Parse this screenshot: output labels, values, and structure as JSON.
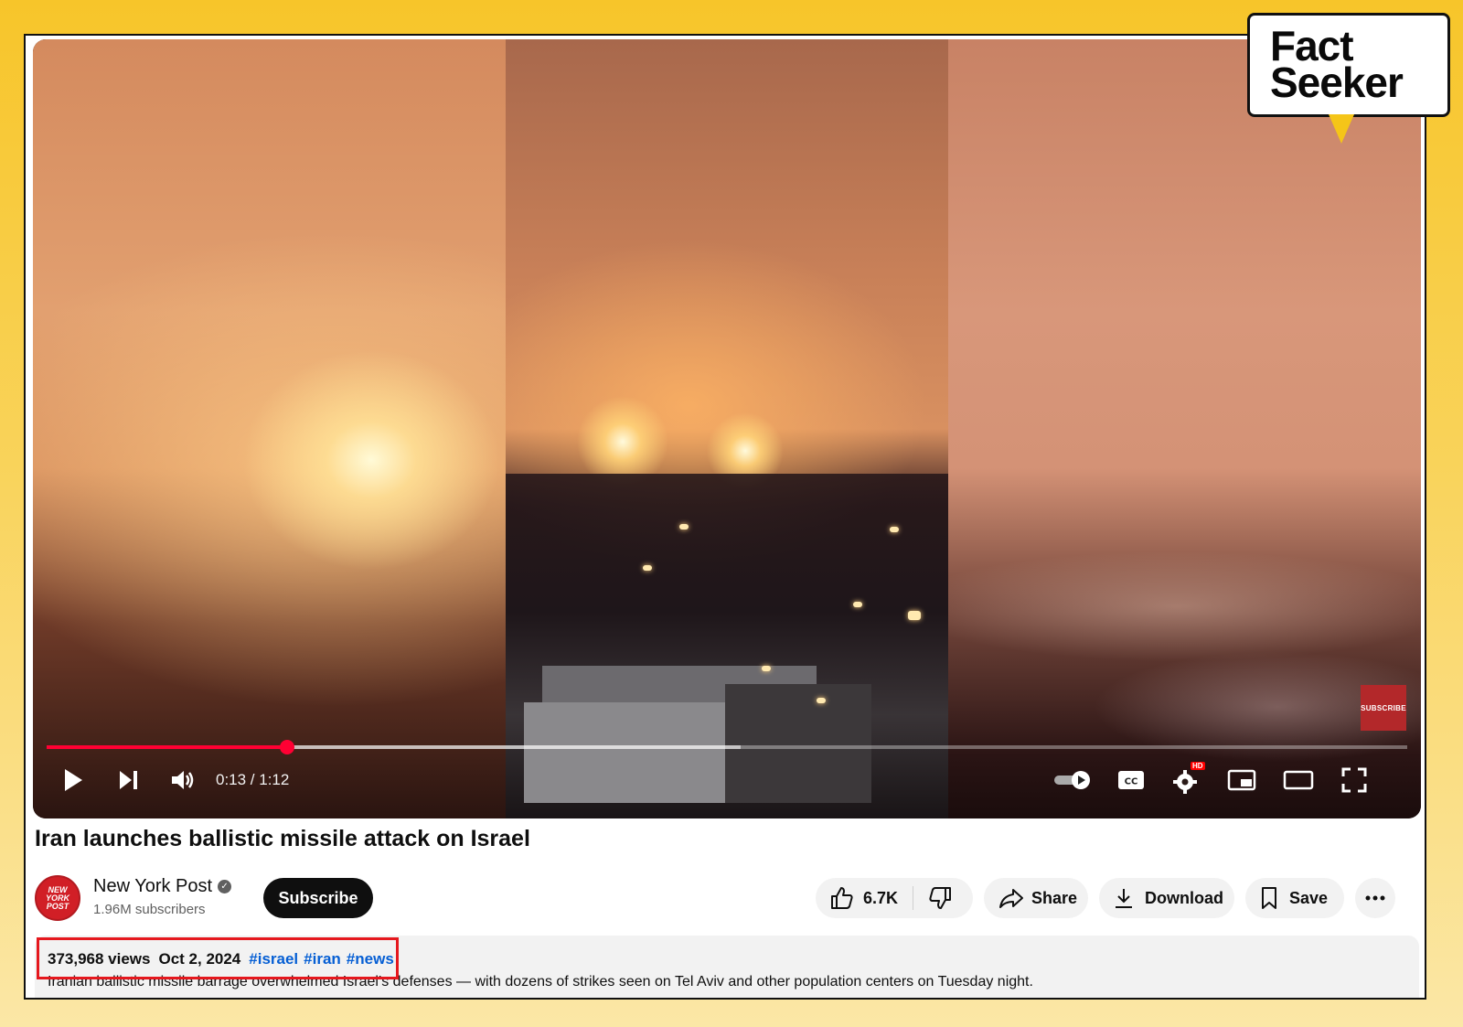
{
  "logo": {
    "line1": "Fact",
    "line2": "Seeker"
  },
  "player": {
    "time": "0:13 / 1:12",
    "progress_fraction": 0.177,
    "buffer_fraction": 0.51,
    "subscribe_badge": "SUBSCRIBE",
    "hd_badge": "HD",
    "accent": "#ff0033"
  },
  "video": {
    "title": "Iran launches ballistic missile attack on Israel"
  },
  "channel": {
    "name": "New York Post",
    "avatar_text": "NEW YORK POST",
    "subscribers": "1.96M subscribers",
    "subscribe_label": "Subscribe"
  },
  "actions": {
    "likes": "6.7K",
    "share_label": "Share",
    "download_label": "Download",
    "save_label": "Save"
  },
  "description": {
    "views": "373,968 views",
    "date": "Oct 2, 2024",
    "tags": [
      "#israel",
      "#iran",
      "#news"
    ],
    "text": "Iranian ballistic missile barrage overwhelmed Israel’s defenses — with dozens of strikes seen on Tel Aviv and other population centers on Tuesday night."
  }
}
